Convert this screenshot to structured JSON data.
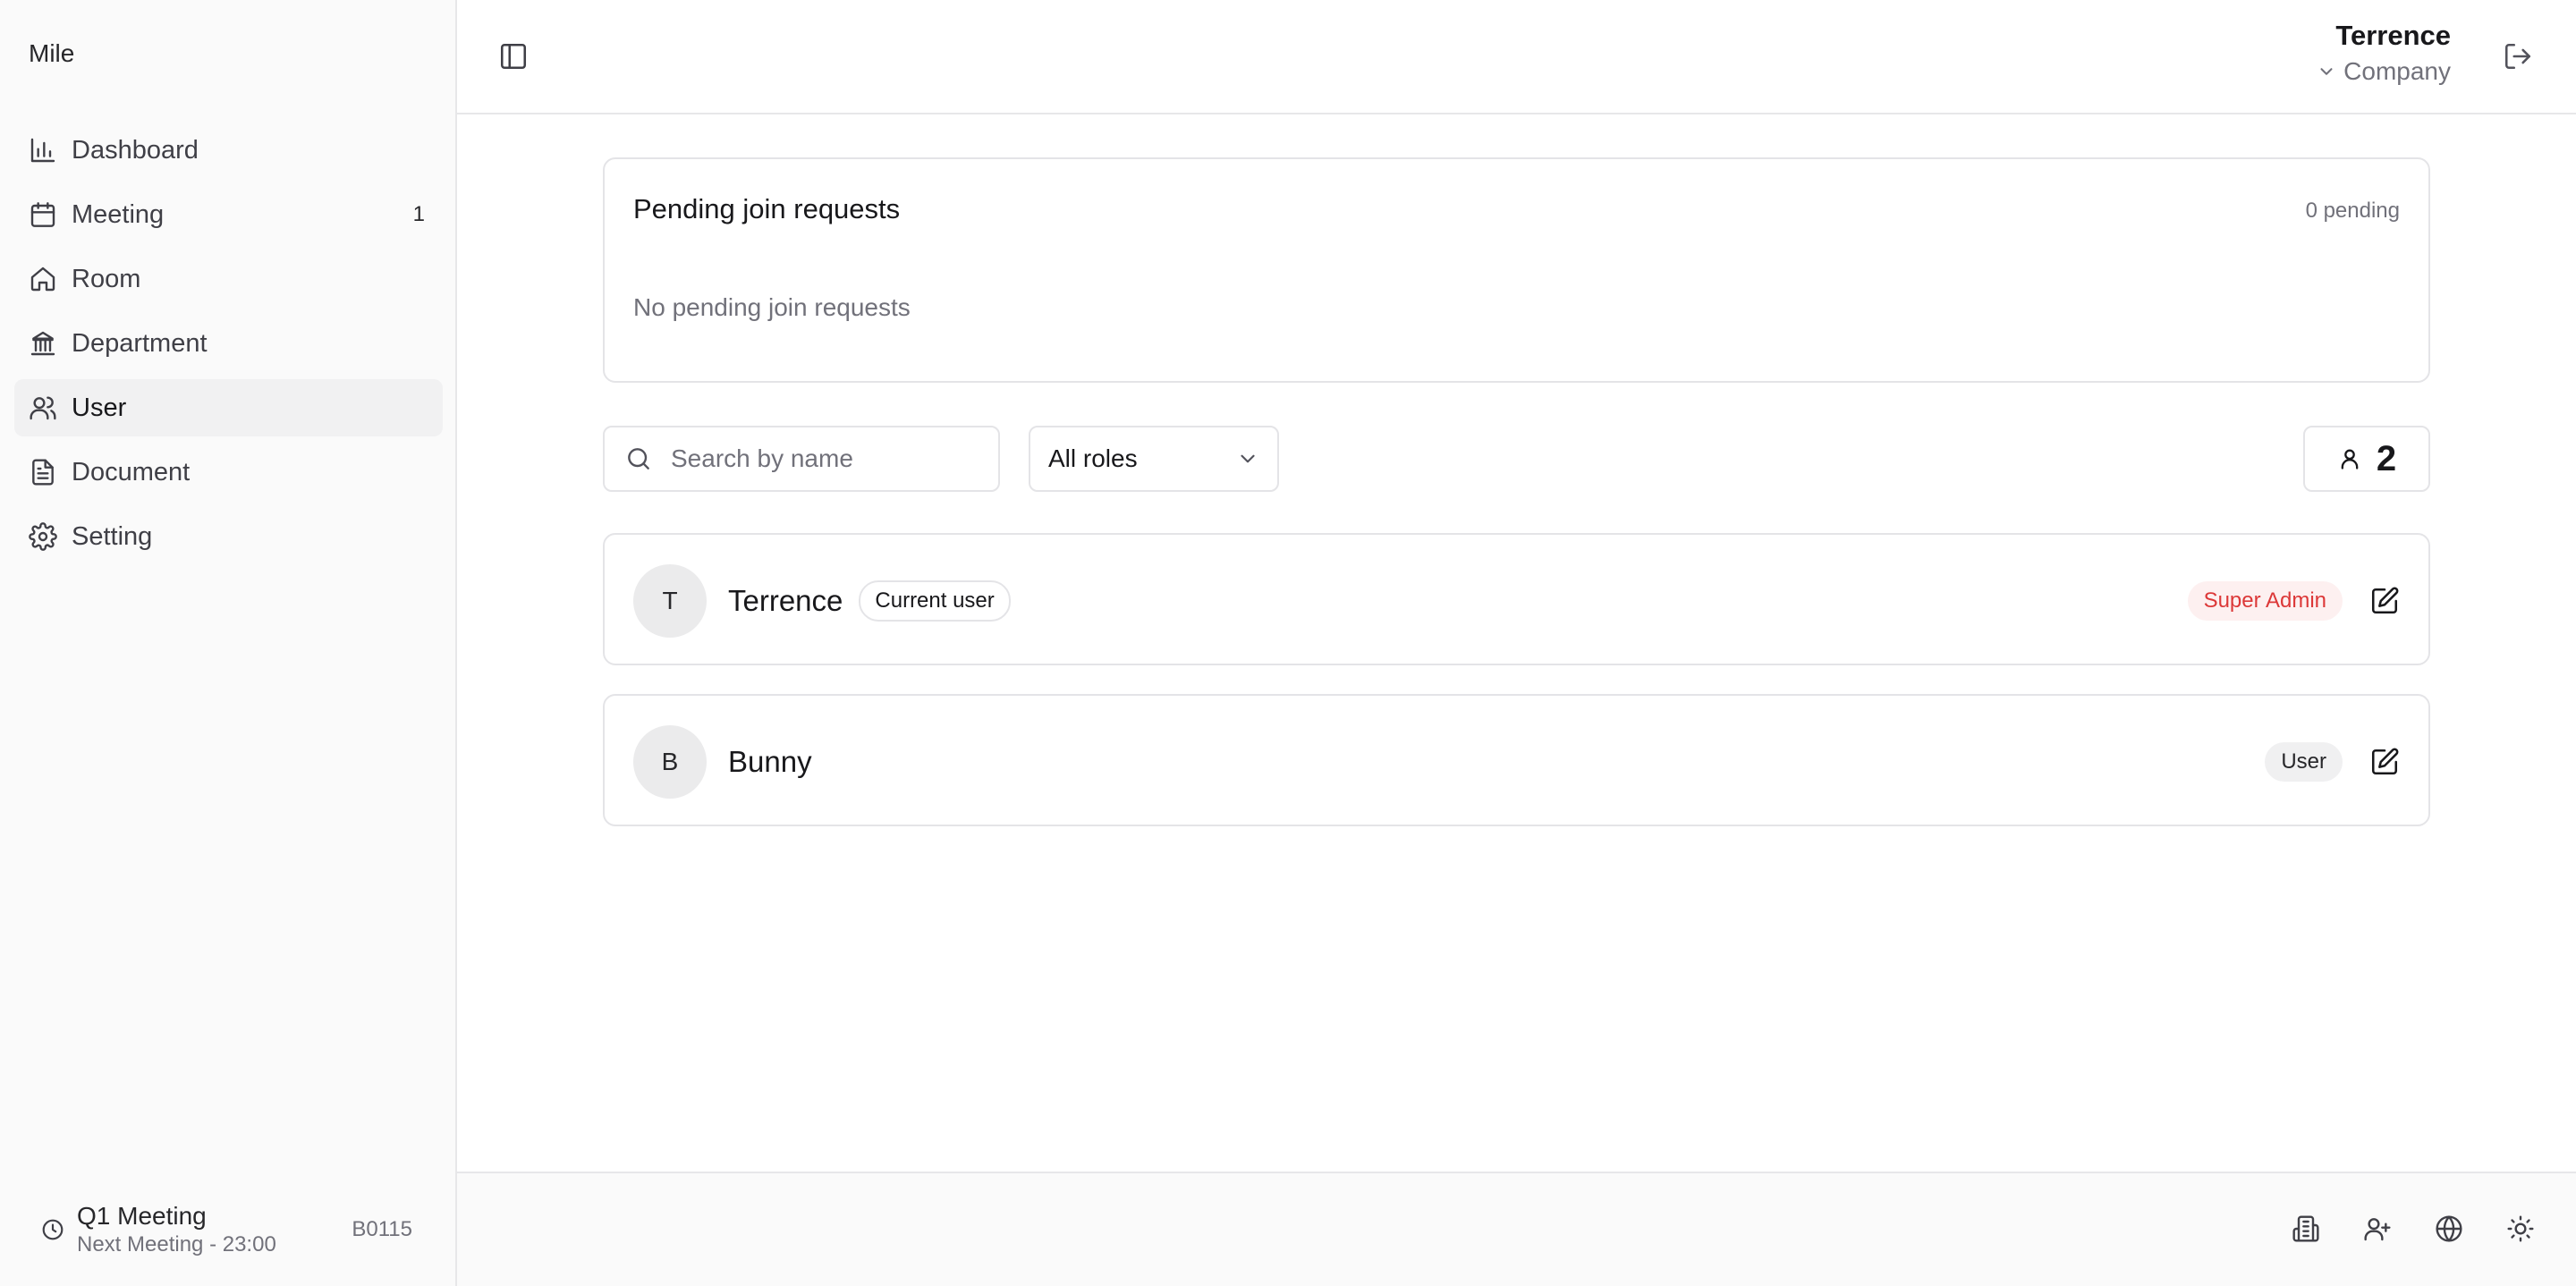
{
  "app": {
    "name": "Mile"
  },
  "sidebar": {
    "items": [
      {
        "label": "Dashboard",
        "icon": "bar-chart-icon",
        "count": ""
      },
      {
        "label": "Meeting",
        "icon": "calendar-icon",
        "count": "1"
      },
      {
        "label": "Room",
        "icon": "home-icon",
        "count": ""
      },
      {
        "label": "Department",
        "icon": "landmark-icon",
        "count": ""
      },
      {
        "label": "User",
        "icon": "users-icon",
        "count": ""
      },
      {
        "label": "Document",
        "icon": "file-text-icon",
        "count": ""
      },
      {
        "label": "Setting",
        "icon": "gear-icon",
        "count": ""
      }
    ],
    "active": "User",
    "footer": {
      "meeting_title": "Q1 Meeting",
      "meeting_subtitle": "Next Meeting - 23:00",
      "room_code": "B0115"
    }
  },
  "header": {
    "user_name": "Terrence",
    "company_label": "Company"
  },
  "pending": {
    "title": "Pending join requests",
    "count_label": "0 pending",
    "empty_text": "No pending join requests"
  },
  "toolbar": {
    "search_placeholder": "Search by name",
    "search_value": "",
    "role_filter": "All roles",
    "user_count": "2"
  },
  "users": [
    {
      "initial": "T",
      "name": "Terrence",
      "current_tag": "Current user",
      "role": "Super Admin"
    },
    {
      "initial": "B",
      "name": "Bunny",
      "current_tag": "",
      "role": "User"
    }
  ],
  "colors": {
    "accent_danger": "#dc3838",
    "sidebar_bg": "#fafafa",
    "border": "#e4e4e7"
  }
}
